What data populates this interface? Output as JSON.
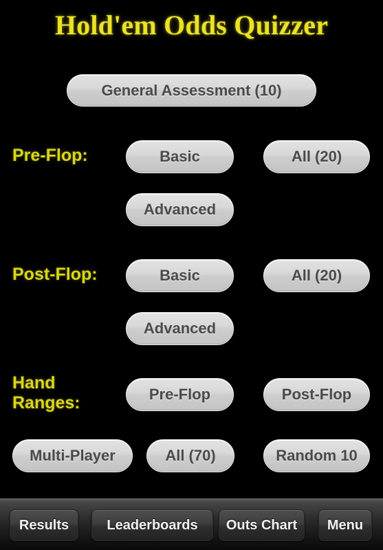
{
  "app": {
    "title": "Hold'em Odds Quizzer",
    "background_color": "#000000",
    "title_color": "#e9e226",
    "label_color": "#d9d61f",
    "button_face_color": "#d8d8d8",
    "button_text_color": "#4a4a4a",
    "toolbar_button_text_color": "#f2f2f2"
  },
  "general": {
    "assessment_label": "General Assessment (10)"
  },
  "sections": [
    {
      "label": "Pre-Flop:",
      "buttons": [
        {
          "label": "Basic"
        },
        {
          "label": "All (20)"
        },
        {
          "label": "Advanced"
        }
      ]
    },
    {
      "label": "Post-Flop:",
      "buttons": [
        {
          "label": "Basic"
        },
        {
          "label": "All (20)"
        },
        {
          "label": "Advanced"
        }
      ]
    },
    {
      "label": "Hand\nRanges:",
      "buttons": [
        {
          "label": "Pre-Flop"
        },
        {
          "label": "Post-Flop"
        }
      ]
    }
  ],
  "extra_row": [
    {
      "label": "Multi-Player"
    },
    {
      "label": "All (70)"
    },
    {
      "label": "Random 10"
    }
  ],
  "toolbar": {
    "items": [
      {
        "label": "Results"
      },
      {
        "label": "Leaderboards"
      },
      {
        "label": "Outs Chart"
      },
      {
        "label": "Menu"
      }
    ]
  }
}
